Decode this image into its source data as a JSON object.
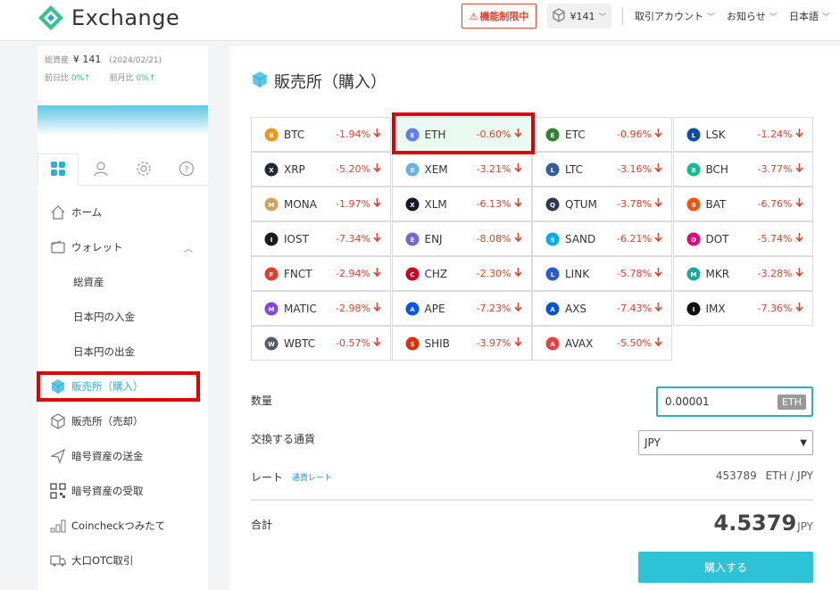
{
  "header": {
    "logo_text": "Exchange",
    "warning_label": "機能制限中",
    "balance_label": "¥141",
    "menu": [
      {
        "label": "取引アカウント"
      },
      {
        "label": "お知らせ"
      },
      {
        "label": "日本語"
      }
    ]
  },
  "sidebar": {
    "total_assets_label": "総資産",
    "total_assets_value": "¥ 141",
    "date": "(2024/02/21)",
    "day_change_label": "前日比",
    "day_change_value": "0%↑",
    "month_change_label": "前月比",
    "month_change_value": "0%↑",
    "tabs": [
      "grid-icon",
      "user-icon",
      "gear-icon",
      "help-icon"
    ],
    "nav": [
      {
        "label": "ホーム"
      },
      {
        "label": "ウォレット"
      },
      {
        "label": "総資産"
      },
      {
        "label": "日本円の入金"
      },
      {
        "label": "日本円の出金"
      },
      {
        "label": "販売所（購入）"
      },
      {
        "label": "販売所（売却）"
      },
      {
        "label": "暗号資産の送金"
      },
      {
        "label": "暗号資産の受取"
      },
      {
        "label": "Coincheckつみたて"
      },
      {
        "label": "大口OTC取引"
      }
    ]
  },
  "main": {
    "title": "販売所（購入）",
    "coins": [
      {
        "sym": "BTC",
        "chg": "-1.94%",
        "color": "#f7931a"
      },
      {
        "sym": "ETH",
        "chg": "-0.60%",
        "color": "#627eea"
      },
      {
        "sym": "ETC",
        "chg": "-0.96%",
        "color": "#328332"
      },
      {
        "sym": "LSK",
        "chg": "-1.24%",
        "color": "#0d4ea0"
      },
      {
        "sym": "XRP",
        "chg": "-5.20%",
        "color": "#23292f"
      },
      {
        "sym": "XEM",
        "chg": "-3.21%",
        "color": "#67b2e8"
      },
      {
        "sym": "LTC",
        "chg": "-3.16%",
        "color": "#345d9d"
      },
      {
        "sym": "BCH",
        "chg": "-3.77%",
        "color": "#0ac18e"
      },
      {
        "sym": "MONA",
        "chg": "-1.97%",
        "color": "#d3a15f"
      },
      {
        "sym": "XLM",
        "chg": "-6.13%",
        "color": "#14182b"
      },
      {
        "sym": "QTUM",
        "chg": "-3.78%",
        "color": "#2e3a4c"
      },
      {
        "sym": "BAT",
        "chg": "-6.76%",
        "color": "#ff5000"
      },
      {
        "sym": "IOST",
        "chg": "-7.34%",
        "color": "#1c1c1c"
      },
      {
        "sym": "ENJ",
        "chg": "-8.08%",
        "color": "#7866d5"
      },
      {
        "sym": "SAND",
        "chg": "-6.21%",
        "color": "#00adef"
      },
      {
        "sym": "DOT",
        "chg": "-5.74%",
        "color": "#e6007a"
      },
      {
        "sym": "FNCT",
        "chg": "-2.94%",
        "color": "#e43c2f"
      },
      {
        "sym": "CHZ",
        "chg": "-2.30%",
        "color": "#cd0124"
      },
      {
        "sym": "LINK",
        "chg": "-5.78%",
        "color": "#2a5ada"
      },
      {
        "sym": "MKR",
        "chg": "-3.28%",
        "color": "#1aab9b"
      },
      {
        "sym": "MATIC",
        "chg": "-2.98%",
        "color": "#8247e5"
      },
      {
        "sym": "APE",
        "chg": "-7.23%",
        "color": "#0054f9"
      },
      {
        "sym": "AXS",
        "chg": "-7.43%",
        "color": "#0055d5"
      },
      {
        "sym": "IMX",
        "chg": "-7.36%",
        "color": "#111111"
      },
      {
        "sym": "WBTC",
        "chg": "-0.57%",
        "color": "#5a5a6e"
      },
      {
        "sym": "SHIB",
        "chg": "-3.97%",
        "color": "#e42d04"
      },
      {
        "sym": "AVAX",
        "chg": "-5.50%",
        "color": "#e84142"
      }
    ],
    "qty_label": "数量",
    "qty_value": "0.00001",
    "qty_unit": "ETH",
    "currency_label": "交換する通貨",
    "currency_selected": "JPY",
    "rate_label": "レート",
    "rate_link": "通貨レート",
    "rate_value": "453789",
    "rate_unit": "ETH / JPY",
    "total_label": "合計",
    "total_value": "4.5379",
    "total_currency": "JPY",
    "buy_button": "購入する"
  },
  "colors": {
    "accent": "#2ec2d6",
    "negative": "#e0402a",
    "highlight": "#e00000"
  }
}
